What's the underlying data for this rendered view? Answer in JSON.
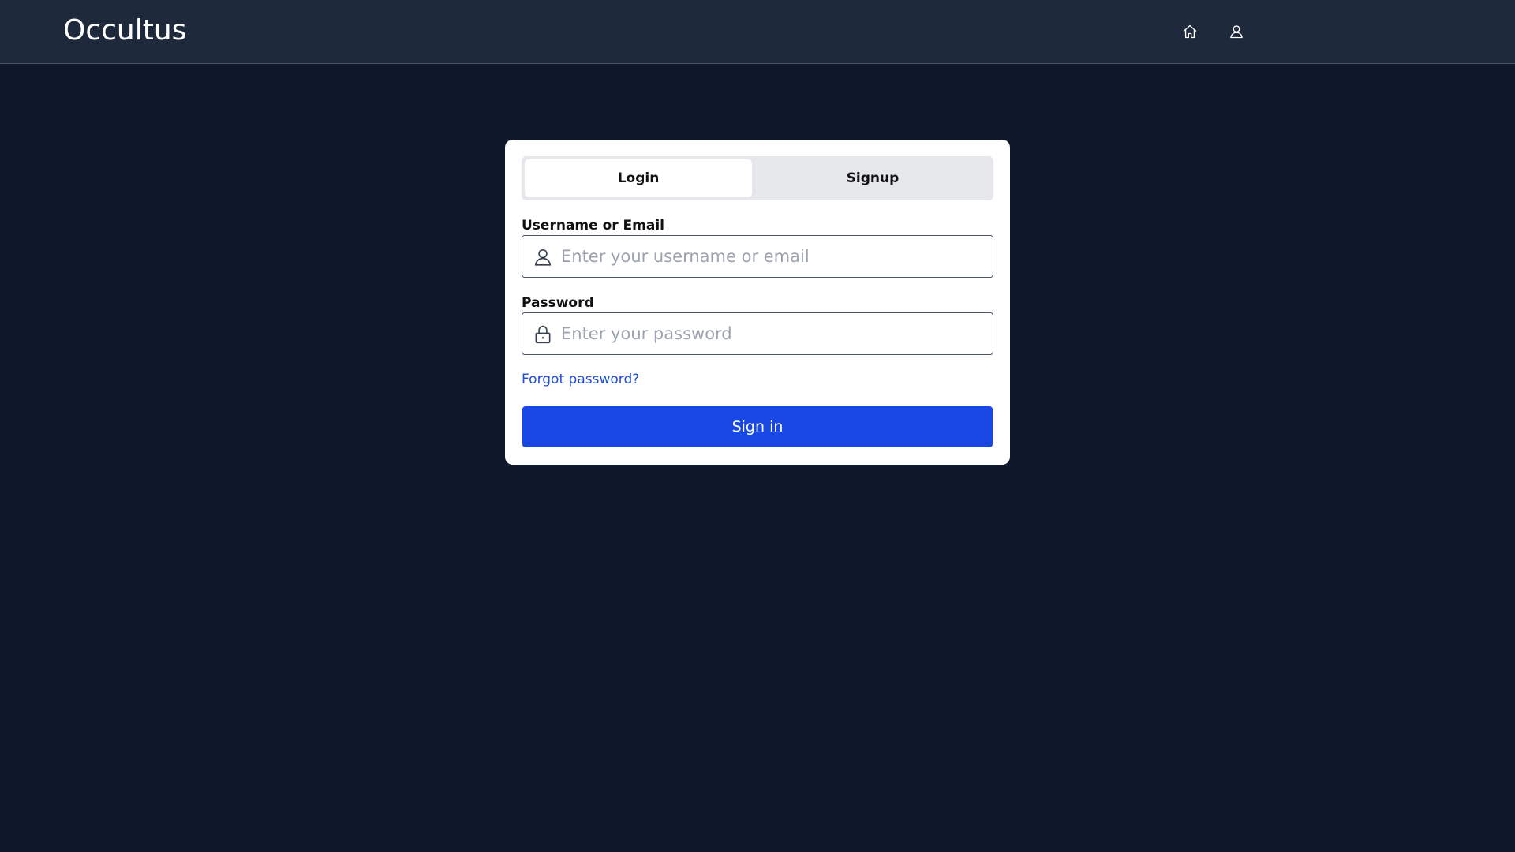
{
  "app": {
    "brand": "Occultus"
  },
  "nav": {
    "icons": [
      "home-icon",
      "user-icon"
    ]
  },
  "auth": {
    "tabs": [
      {
        "label": "Login",
        "active": true
      },
      {
        "label": "Signup",
        "active": false
      }
    ],
    "username_label": "Username or Email",
    "username_placeholder": "Enter your username or email",
    "username_value": "",
    "password_label": "Password",
    "password_placeholder": "Enter your password",
    "password_value": "",
    "forgot_label": "Forgot password?",
    "submit_label": "Sign in"
  },
  "colors": {
    "page_bg": "#0f172a",
    "header_bg": "#1e293b",
    "primary": "#1847e6",
    "link": "#1d4ed8"
  }
}
